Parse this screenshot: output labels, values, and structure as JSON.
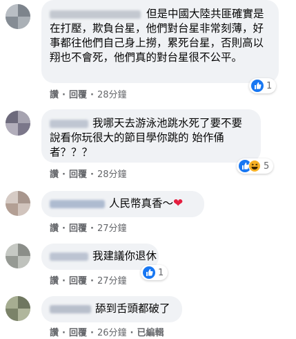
{
  "colors": {
    "bubble": "#f0f2f5",
    "meta": "#65676b",
    "like": "#1877f2",
    "haha": "#f7b125",
    "heart": "#e41e3f"
  },
  "comments": [
    {
      "text": "但是中國大陸共匪確實是在打壓，欺負台星，他們對台星非常刻薄，好事都往他們自己身上撈，累死台星，否則高以翔也不會死，他們真的對台星很不公平。",
      "actions": {
        "like": "讚",
        "reply": "回覆",
        "time": "28分鐘"
      },
      "reactions": {
        "types": [
          "like-icon"
        ],
        "count": "1"
      }
    },
    {
      "text": "我哪天去游泳池跳水死了要不要說看你玩很大的節目學你跳的 始作俑者？？？",
      "actions": {
        "like": "讚",
        "reply": "回覆",
        "time": "28分鐘"
      },
      "reactions": {
        "types": [
          "like-icon",
          "haha-icon"
        ],
        "count": "5"
      }
    },
    {
      "text": "人民幣真香～",
      "emoji": "heart-icon",
      "actions": {
        "like": "讚",
        "reply": "回覆",
        "time": "27分鐘"
      }
    },
    {
      "text": "我建議你退休",
      "actions": {
        "like": "讚",
        "reply": "回覆",
        "time": "27分鐘"
      },
      "reactions": {
        "types": [
          "like-icon"
        ],
        "count": "1"
      }
    },
    {
      "text": "舔到舌頭都破了",
      "actions": {
        "like": "讚",
        "reply": "回覆",
        "time": "26分鐘",
        "edited": "已編輯"
      }
    }
  ]
}
